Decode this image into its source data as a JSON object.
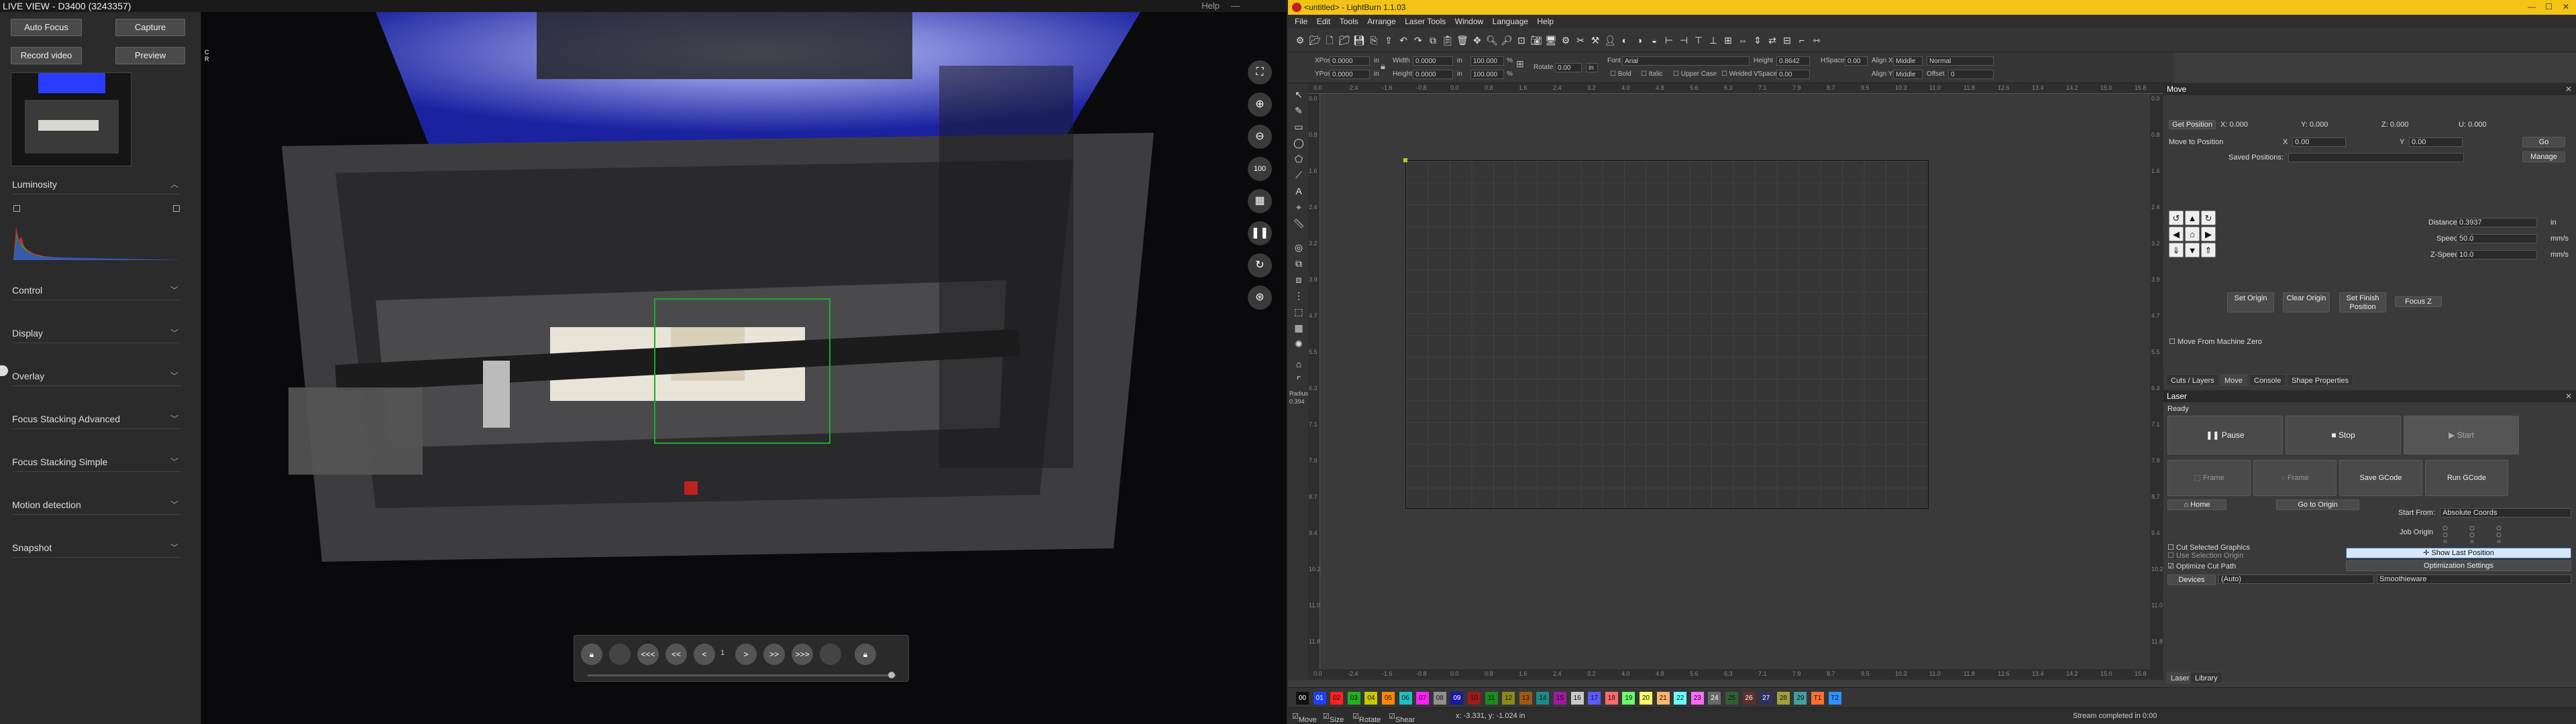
{
  "liveview": {
    "title": "LIVE VIEW - D3400 (3243357)",
    "help": "Help",
    "min": "—",
    "buttons": {
      "auto_focus": "Auto Focus",
      "capture": "Capture",
      "record_video": "Record video",
      "preview": "Preview"
    },
    "sections": [
      "Luminosity",
      "Control",
      "Display",
      "Overlay",
      "Focus Stacking Advanced",
      "Focus Stacking Simple",
      "Motion detection",
      "Snapshot"
    ],
    "cam_indicator": "C",
    "cam_indicator2": "R",
    "playback": {
      "b1": "<<<",
      "b2": "<<",
      "b3": "<",
      "b4": ">",
      "b5": ">>",
      "b6": ">>>",
      "index": "1"
    }
  },
  "lightburn": {
    "title": "<untitled> - LightBurn 1.1.03",
    "menu": [
      "File",
      "Edit",
      "Tools",
      "Arrange",
      "Laser Tools",
      "Window",
      "Language",
      "Help"
    ],
    "shape_props": {
      "xpos_label": "XPos",
      "xpos": "0.0000",
      "ypos_label": "YPos",
      "ypos": "0.0000",
      "unit": "in",
      "width_label": "Width",
      "width": "0.0000",
      "height_label": "Height",
      "height": "0.0000",
      "pct1": "100.000",
      "pct2": "100.000",
      "pct_unit": "%",
      "rotate_label": "Rotate",
      "rotate": "0.00",
      "in_btn": "in",
      "font_label": "Font",
      "font": "Arial",
      "font_height_label": "Height",
      "font_height": "0.8642",
      "hspace_label": "HSpace",
      "hspace": "0.00",
      "vspace_label": "VSpace",
      "vspace": "0.00",
      "align_x_label": "Align X",
      "align_x": "Middle",
      "align_y_label": "Align Y",
      "align_y": "Middle",
      "normal": "Normal",
      "offset_label": "Offset",
      "offset": "0",
      "bold": "Bold",
      "italic": "Italic",
      "upper": "Upper Case",
      "welded": "Welded"
    },
    "ruler_top": [
      "0.0",
      "-2.4",
      "-1.6",
      "-0.8",
      "0.0",
      "0.8",
      "1.6",
      "2.4",
      "3.2",
      "4.0",
      "4.8",
      "5.6",
      "6.3",
      "7.1",
      "7.9",
      "8.7",
      "9.5",
      "10.3",
      "11.0",
      "11.8",
      "12.6",
      "13.4",
      "14.2",
      "15.0",
      "15.8"
    ],
    "ruler_left": [
      "0.0",
      "0.8",
      "1.6",
      "2.4",
      "3.2",
      "3.9",
      "4.7",
      "5.5",
      "6.3",
      "7.1",
      "7.9",
      "8.7",
      "9.4",
      "10.2",
      "11.0",
      "11.8"
    ],
    "move": {
      "header": "Move",
      "get_position": "Get Position",
      "x_lbl": "X: 0.000",
      "y_lbl": "Y: 0.000",
      "z_lbl": "Z: 0.000",
      "u_lbl": "U: 0.000",
      "move_to_position": "Move to Position",
      "x": "X",
      "x_val": "0.00",
      "y": "Y",
      "y_val": "0.00",
      "go": "Go",
      "saved_positions": "Saved Positions:",
      "manage": "Manage",
      "distance_lbl": "Distance",
      "distance": "0.3937",
      "distance_unit": "in",
      "speed_lbl": "Speed",
      "speed": "50.0",
      "speed_unit": "mm/s",
      "zspeed_lbl": "Z-Speed",
      "zspeed": "10.0",
      "zspeed_unit": "mm/s",
      "set_origin": "Set Origin",
      "clear_origin": "Clear Origin",
      "set_finish": "Set Finish Position",
      "focus_z": "Focus Z",
      "move_from_zero": "Move From Machine Zero"
    },
    "tabs": [
      "Cuts / Layers",
      "Move",
      "Console",
      "Shape Properties"
    ],
    "laser": {
      "header": "Laser",
      "status": "Ready",
      "pause": "Pause",
      "stop": "Stop",
      "start": "Start",
      "frame1": "Frame",
      "frame2": "Frame",
      "save_gcode": "Save GCode",
      "run_gcode": "Run GCode",
      "home": "Home",
      "go_to_origin": "Go to Origin",
      "start_from_lbl": "Start From:",
      "start_from": "Absolute Coords",
      "job_origin": "Job Origin",
      "cut_selected": "Cut Selected Graphics",
      "use_selection_origin": "Use Selection Origin",
      "show_last_position": "Show Last Position",
      "optimize_cut_path": "Optimize Cut Path",
      "optimization_settings": "Optimization Settings",
      "devices": "Devices",
      "auto": "(Auto)",
      "device_name": "Smoothieware"
    },
    "bottom_tabs": [
      "Laser",
      "Library"
    ],
    "palette": [
      "00",
      "01",
      "02",
      "03",
      "04",
      "05",
      "06",
      "07",
      "08",
      "09",
      "10",
      "11",
      "12",
      "13",
      "14",
      "15",
      "16",
      "17",
      "18",
      "19",
      "20",
      "21",
      "22",
      "23",
      "24",
      "25",
      "26",
      "27",
      "28",
      "29",
      "T1",
      "T2"
    ],
    "palette_colors": [
      "#111111",
      "#1f3fff",
      "#ff2020",
      "#20b020",
      "#c8c800",
      "#ff8800",
      "#20c0c0",
      "#ff20ff",
      "#909090",
      "#1a1aa0",
      "#a01a1a",
      "#1a8a1a",
      "#8a8a1a",
      "#a05a10",
      "#1a8a8a",
      "#a01aa0",
      "#c8c8c8",
      "#5a5aff",
      "#ff6a6a",
      "#6aff6a",
      "#ffff6a",
      "#ffb46a",
      "#6affff",
      "#ff6aff",
      "#6a6a6a",
      "#306030",
      "#603030",
      "#303060",
      "#a0a040",
      "#40a0a0",
      "#ff7030",
      "#3090ff"
    ],
    "status": {
      "move": "Move",
      "size": "Size",
      "rotate": "Rotate",
      "shear": "Shear",
      "coords": "x: -3.331, y: -1.024 in",
      "stream": "Stream completed in 0:00"
    },
    "radius_lbl": "Radius:",
    "radius": "0.394"
  }
}
